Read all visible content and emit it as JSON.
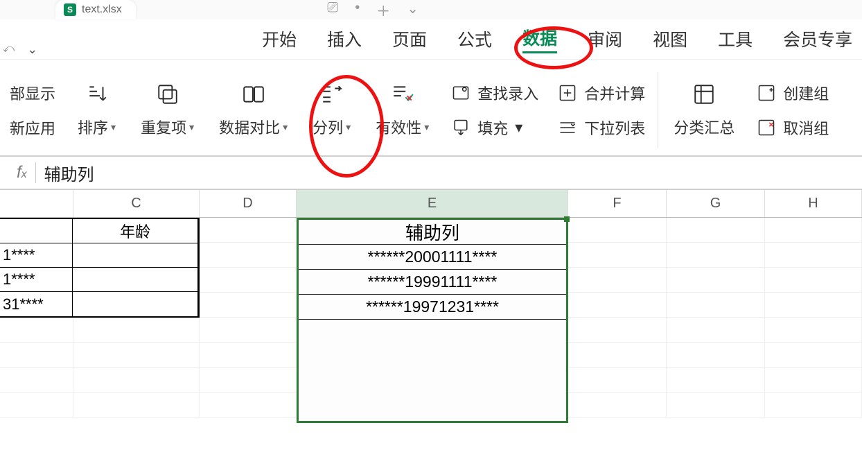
{
  "doc": {
    "filename": "text.xlsx"
  },
  "menu": {
    "tabs": [
      "开始",
      "插入",
      "页面",
      "公式",
      "数据",
      "审阅",
      "视图",
      "工具",
      "会员专享"
    ],
    "active_index": 4
  },
  "ribbon": {
    "left": {
      "top": "部显示",
      "bottom": "新应用"
    },
    "sort": "排序",
    "dup": "重复项",
    "compare": "数据对比",
    "split": "分列",
    "valid": "有效性",
    "find_entry": "查找录入",
    "fill": "填充",
    "merge_calc": "合并计算",
    "dropdown": "下拉列表",
    "subtotal": "分类汇总",
    "create_grp": "创建组",
    "cancel_grp": "取消组"
  },
  "formula_bar": {
    "value": "辅助列"
  },
  "columns": [
    "C",
    "D",
    "E",
    "F",
    "G",
    "H"
  ],
  "left_table": {
    "header": "年龄",
    "rows": [
      "1****",
      "1****",
      "31****"
    ]
  },
  "e_column": {
    "header": "辅助列",
    "rows": [
      "******20001111****",
      "******19991111****",
      "******19971231****"
    ]
  }
}
